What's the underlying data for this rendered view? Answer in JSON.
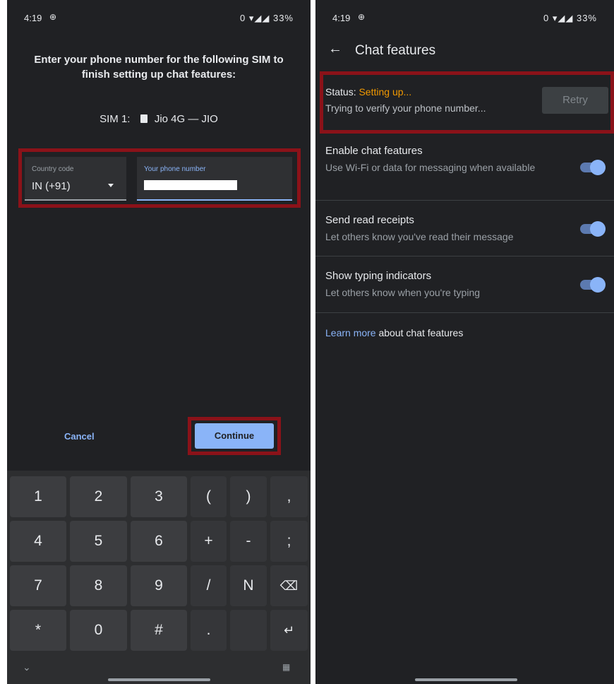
{
  "colors": {
    "background": "#202124",
    "accent": "#8ab4f8",
    "highlight": "#8b1219",
    "warning": "#f29900"
  },
  "left": {
    "status": {
      "time": "4:19",
      "time_icon": "⊕",
      "right": "0 ▾◢◢ 33%"
    },
    "instruction": "Enter your phone number for the following SIM to finish setting up chat features:",
    "sim_label": "SIM 1:",
    "sim_name": "Jio 4G — JIO",
    "country_field": {
      "label": "Country code",
      "value": "IN (+91)"
    },
    "phone_field": {
      "label": "Your phone number"
    },
    "cancel_label": "Cancel",
    "continue_label": "Continue",
    "keys": [
      [
        "1",
        "2",
        "3",
        "(",
        ")",
        ","
      ],
      [
        "4",
        "5",
        "6",
        "+",
        "-",
        ";"
      ],
      [
        "7",
        "8",
        "9",
        "/",
        "N",
        "⌫"
      ],
      [
        "*",
        "0",
        "#",
        ".",
        "",
        "↵"
      ]
    ],
    "kb_hide": "⌄",
    "kb_switch": "▦"
  },
  "right": {
    "status": {
      "time": "4:19",
      "time_icon": "⊕",
      "right": "0 ▾◢◢ 33%"
    },
    "back_icon": "←",
    "title": "Chat features",
    "status_prefix": "Status: ",
    "status_value": "Setting up...",
    "status_detail": "Trying to verify your phone number...",
    "retry_label": "Retry",
    "settings": [
      {
        "title": "Enable chat features",
        "subtitle": "Use Wi-Fi or data for messaging when available",
        "on": true
      },
      {
        "title": "Send read receipts",
        "subtitle": "Let others know you've read their message",
        "on": true
      },
      {
        "title": "Show typing indicators",
        "subtitle": "Let others know when you're typing",
        "on": true
      }
    ],
    "learn_more_link": "Learn more",
    "learn_more_rest": " about chat features"
  }
}
